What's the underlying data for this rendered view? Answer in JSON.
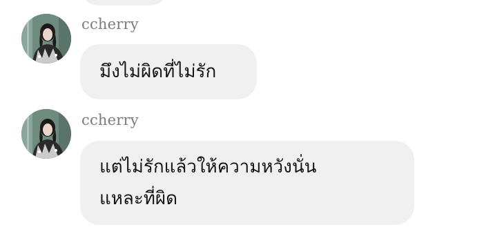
{
  "messages": [
    {
      "sender": "ccherry",
      "text": "มึงไม่ผิดที่ไม่รัก",
      "avatar": "profile-photo"
    },
    {
      "sender": "ccherry",
      "lines": [
        "แต่ไม่รักแล้วให้ความหวังนั่น",
        "แหละที่ผิด"
      ],
      "avatar": "profile-photo"
    }
  ],
  "colors": {
    "bubble": "#f0f0f0",
    "sender_text": "#7b7b7b",
    "message_text": "#151515",
    "background": "#ffffff"
  }
}
